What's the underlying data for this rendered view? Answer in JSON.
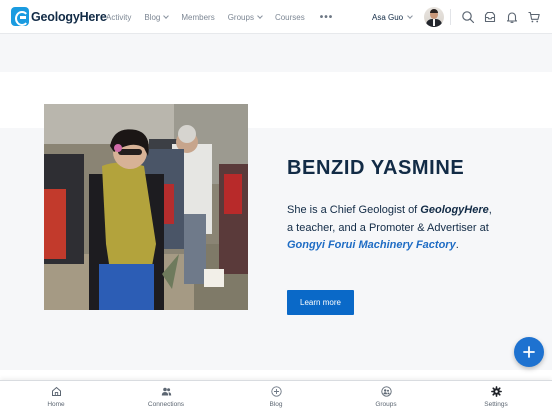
{
  "brand": {
    "name": "GeologyHere"
  },
  "nav": {
    "items": [
      {
        "label": "Activity",
        "has_caret": false
      },
      {
        "label": "Blog",
        "has_caret": true
      },
      {
        "label": "Members",
        "has_caret": false
      },
      {
        "label": "Groups",
        "has_caret": true
      },
      {
        "label": "Courses",
        "has_caret": false
      }
    ],
    "more": "•••"
  },
  "user": {
    "name": "Asa Guo"
  },
  "header_icons": [
    "search-icon",
    "inbox-icon",
    "bell-icon",
    "cart-icon"
  ],
  "hero": {
    "name": "BENZID YASMINE",
    "line1_pre": "She is a Chief Geologist of ",
    "line1_em": "GeologyHere",
    "line1_post": ",",
    "line2": "a teacher, and a Promoter & Advertiser at",
    "company": "Gongyi Forui Machinery Factory",
    "company_post": ".",
    "button": "Learn more"
  },
  "tabs": [
    {
      "label": "Home",
      "icon": "home-icon"
    },
    {
      "label": "Connections",
      "icon": "connections-icon"
    },
    {
      "label": "Blog",
      "icon": "plus-circle-icon"
    },
    {
      "label": "Groups",
      "icon": "groups-icon"
    },
    {
      "label": "Settings",
      "icon": "gear-icon"
    }
  ],
  "colors": {
    "accent": "#0a69c8",
    "text_dark": "#122b46",
    "link": "#1e6cc4",
    "fab": "#1e72d0"
  }
}
